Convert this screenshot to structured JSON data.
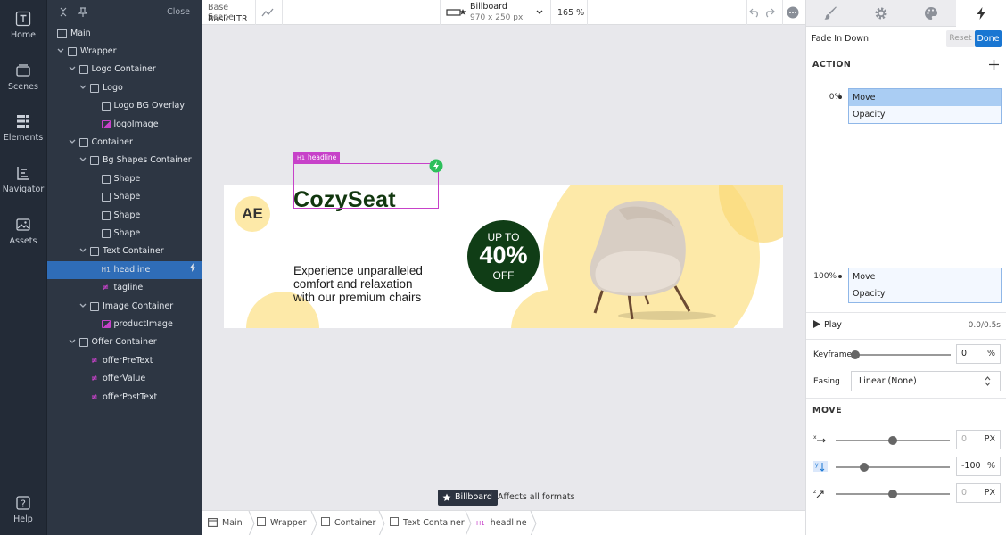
{
  "rail": {
    "items": [
      {
        "label": "Home",
        "icon": "text-t-icon"
      },
      {
        "label": "Scenes",
        "icon": "scenes-icon"
      },
      {
        "label": "Elements",
        "icon": "elements-grid-icon"
      },
      {
        "label": "Navigator",
        "icon": "navigator-icon"
      },
      {
        "label": "Assets",
        "icon": "image-icon"
      }
    ],
    "help": "Help"
  },
  "layers": {
    "close_label": "Close",
    "root": "Main",
    "rows": [
      {
        "label": "Wrapper"
      },
      {
        "label": "Logo Container"
      },
      {
        "label": "Logo"
      },
      {
        "label": "Logo BG Overlay"
      },
      {
        "label": "logoImage"
      },
      {
        "label": "Container"
      },
      {
        "label": "Bg Shapes Container"
      },
      {
        "label": "Shape"
      },
      {
        "label": "Shape"
      },
      {
        "label": "Shape"
      },
      {
        "label": "Shape"
      },
      {
        "label": "Text Container"
      },
      {
        "label": "headline"
      },
      {
        "label": "tagline"
      },
      {
        "label": "Image Container"
      },
      {
        "label": "productImage"
      },
      {
        "label": "Offer Container"
      },
      {
        "label": "offerPreText"
      },
      {
        "label": "offerValue"
      },
      {
        "label": "offerPostText"
      }
    ],
    "h1_tag": "H1"
  },
  "toolbar": {
    "scene_title": "Base Scene",
    "scene_sub": "Basic LTR",
    "format_title": "Billboard",
    "format_size": "970 x 250 px",
    "zoom": "165 %"
  },
  "canvas": {
    "selection_tag": "H1",
    "selection_name": "headline",
    "banner": {
      "logo": "AE",
      "headline": "CozySeat",
      "tagline_lines": [
        "Experience unparalleled",
        "comfort and relaxation",
        "with our premium chairs"
      ],
      "offer_pre": "UP TO",
      "offer_value": "40%",
      "offer_post": "OFF"
    },
    "format_badge": "Billboard",
    "format_note": "Affects all formats"
  },
  "breadcrumb": {
    "items": [
      "Main",
      "Wrapper",
      "Container",
      "Text Container",
      "headline"
    ],
    "h1_tag": "H1"
  },
  "right": {
    "animation_name": "Fade In Down",
    "reset_label": "Reset",
    "done_label": "Done",
    "action_title": "ACTION",
    "kf_start": "0%",
    "kf_end": "100%",
    "kf_start_rows": [
      "Move",
      "Opacity"
    ],
    "kf_end_rows": [
      "Move",
      "Opacity"
    ],
    "play_label": "Play",
    "time": "0.0/0.5s",
    "keyframe_label": "Keyframe",
    "keyframe_value": "0",
    "keyframe_unit": "%",
    "keyframe_fraction": 0,
    "easing_label": "Easing",
    "easing_value": "Linear (None)",
    "move_title": "MOVE",
    "move_rows": [
      {
        "icon": "move-x-icon",
        "value": "0",
        "unit": "PX",
        "slider": 0.5,
        "disabled": true
      },
      {
        "icon": "move-y-icon",
        "value": "-100",
        "unit": "%",
        "slider": 0.25,
        "disabled": false
      },
      {
        "icon": "move-z-icon",
        "value": "0",
        "unit": "PX",
        "slider": 0.5,
        "disabled": true
      }
    ]
  },
  "colors": {
    "accent": "#1976d2",
    "selection": "#c742c9",
    "offer_green": "#103d16",
    "cream": "#fde8a6",
    "headline_green": "#12370f"
  }
}
